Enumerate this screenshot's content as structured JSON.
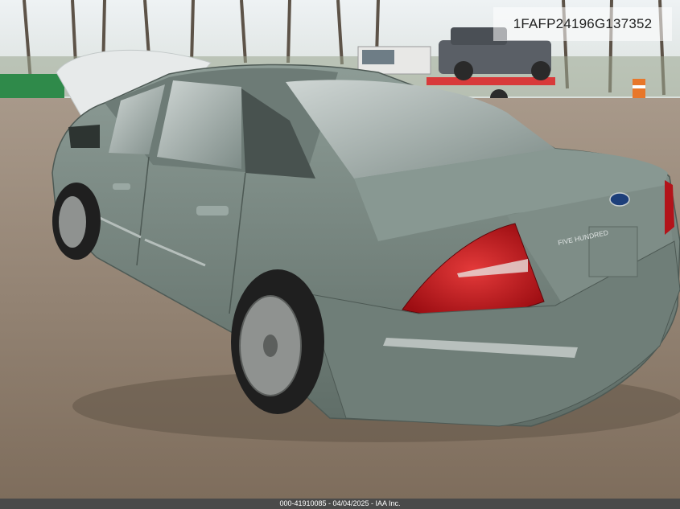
{
  "photo": {
    "vin": "1FAFP24196G137352",
    "footer_caption": "000-41910085 - 04/04/2025 - IAA Inc.",
    "trunk_badge": "FIVE HUNDRED",
    "colors": {
      "car_body": "#7b8a84",
      "tail_light": "#c0121a",
      "ground": "#8f7f6e",
      "sky": "#dfe6ea"
    }
  }
}
